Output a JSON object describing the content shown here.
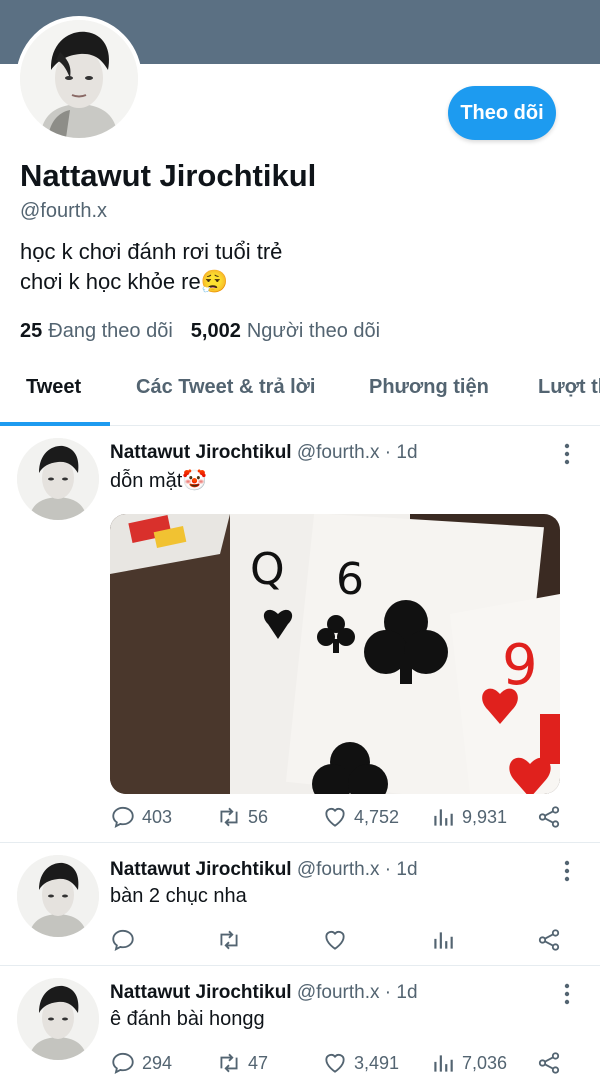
{
  "profile": {
    "display_name": "Nattawut Jirochtikul",
    "handle": "@fourth.x",
    "bio_lines": [
      "học k chơi đánh rơi tuổi trẻ",
      "chơi k học khỏe re😮‍💨"
    ],
    "following_count": "25",
    "following_label": "Đang theo dõi",
    "followers_count": "5,002",
    "followers_label": "Người theo dõi",
    "follow_button_label": "Theo dõi"
  },
  "colors": {
    "banner": "#5b7083",
    "accent": "#1d9bf0",
    "muted": "#536471"
  },
  "tabs": [
    {
      "label": "Tweet",
      "active": true
    },
    {
      "label": "Các Tweet & trả lời",
      "active": false
    },
    {
      "label": "Phương tiện",
      "active": false
    },
    {
      "label": "Lượt thích",
      "active": false
    }
  ],
  "tweets": [
    {
      "author": "Nattawut Jirochtikul",
      "meta": "@fourth.x · 1d",
      "text": "dỗn mặt🤡",
      "has_media": true,
      "media_description_icon": "playing-cards-image",
      "replies": "403",
      "retweets": "56",
      "likes": "4,752",
      "views": "9,931"
    },
    {
      "author": "Nattawut Jirochtikul",
      "meta": "@fourth.x · 1d",
      "text": "bàn 2 chục nha",
      "has_media": false,
      "replies": "",
      "retweets": "",
      "likes": "",
      "views": ""
    },
    {
      "author": "Nattawut Jirochtikul",
      "meta": "@fourth.x · 1d",
      "text": "ê đánh bài hongg",
      "has_media": false,
      "replies": "294",
      "retweets": "47",
      "likes": "3,491",
      "views": "7,036"
    }
  ]
}
